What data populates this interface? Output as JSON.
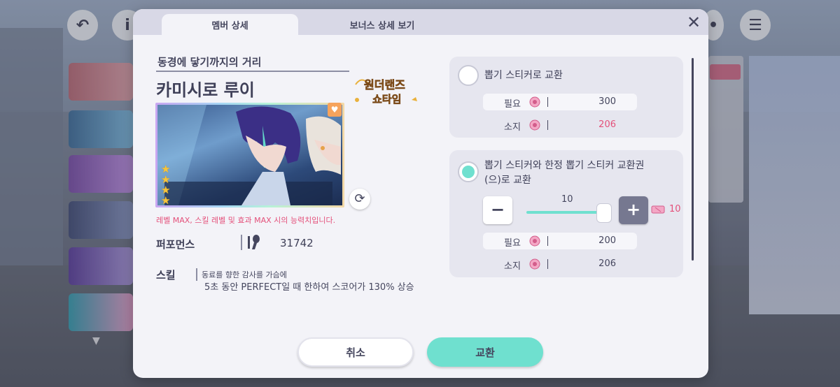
{
  "tabs": {
    "member_detail": "멤버 상세",
    "bonus_detail": "보너스 상세 보기"
  },
  "close_icon": "close-icon",
  "member": {
    "card_title": "동경에 닿기까지의 거리",
    "name": "카미시로 루이",
    "unit": "원더랜즈×쇼타임",
    "rarity_stars": 4,
    "note": "레벨 MAX, 스킬 레벨 및 효과 MAX 시의 능력치입니다.",
    "performance_label": "퍼포먼스",
    "performance_value": "31742",
    "skill_label": "스킬",
    "skill_name": "동료를 향한 감사를 가슴에",
    "skill_desc": "5초 동안 PERFECT일 때 한하여 스코어가 130% 상승"
  },
  "option1": {
    "title": "뽑기 스티커로 교환",
    "required_label": "필요",
    "required_value": "300",
    "owned_label": "소지",
    "owned_value": "206",
    "selected": false
  },
  "option2": {
    "title_line1": "뽑기 스티커와 한정 뽑기 스티커 교환권",
    "title_line2": "(으)로 교환",
    "slider_value": "10",
    "ticket_count": "10",
    "required_label": "필요",
    "required_value": "200",
    "owned_label": "소지",
    "owned_value": "206",
    "minus": "−",
    "plus": "+",
    "selected": true
  },
  "buttons": {
    "cancel": "취소",
    "confirm": "교환"
  },
  "colors": {
    "accent": "#6fe0cf",
    "pink": "#e4507a",
    "text": "#45465e"
  }
}
